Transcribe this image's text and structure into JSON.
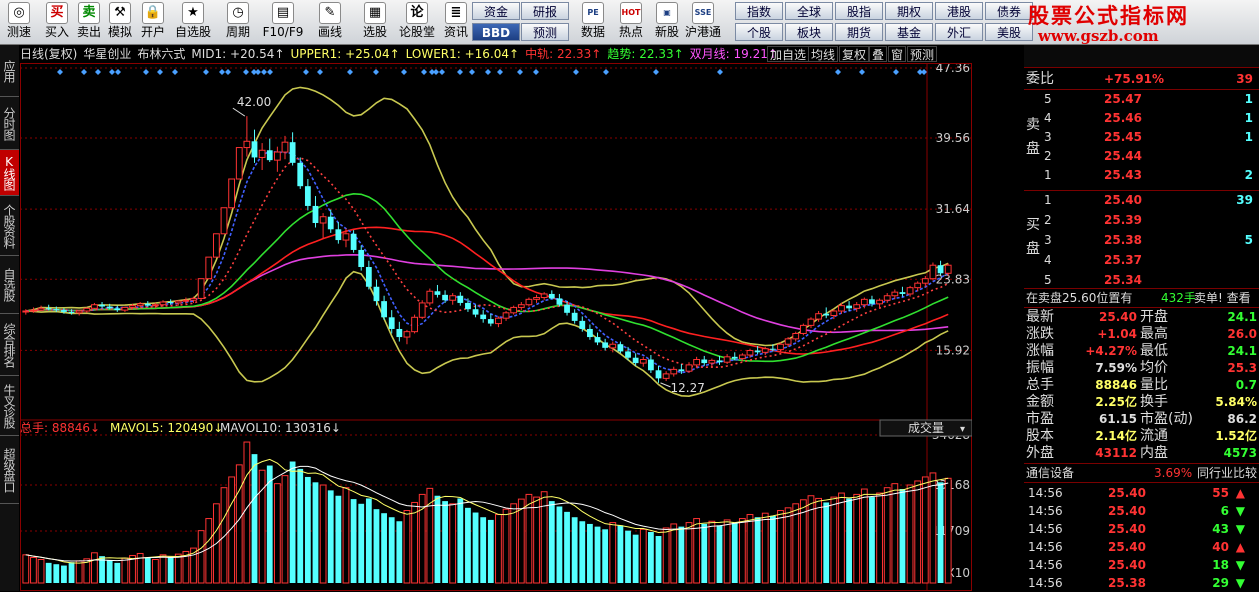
{
  "toolbar": {
    "buttons": [
      {
        "label": "测速",
        "icon": "◎",
        "name": "speed-test"
      },
      {
        "label": "买入",
        "icon": "买",
        "name": "buy"
      },
      {
        "label": "卖出",
        "icon": "卖",
        "name": "sell"
      },
      {
        "label": "模拟",
        "icon": "⚒",
        "name": "simulate"
      },
      {
        "label": "开户",
        "icon": "🔒",
        "name": "open-account"
      },
      {
        "label": "自选股",
        "icon": "★",
        "name": "watchlist"
      },
      {
        "label": "周期",
        "icon": "◷",
        "name": "period"
      },
      {
        "label": "F10/F9",
        "icon": "▤",
        "name": "f10"
      },
      {
        "label": "画线",
        "icon": "✎",
        "name": "draw-line"
      },
      {
        "label": "选股",
        "icon": "▦",
        "name": "stock-select"
      },
      {
        "label": "论股堂",
        "icon": "论",
        "name": "forum"
      },
      {
        "label": "资讯",
        "icon": "≣",
        "name": "news"
      }
    ],
    "mid_buttons": [
      {
        "label": "资金",
        "dark": false
      },
      {
        "label": "研报",
        "dark": false
      },
      {
        "label": "BBD",
        "dark": true
      },
      {
        "label": "预测",
        "dark": false
      }
    ],
    "icon_buttons": [
      {
        "label": "数据",
        "icon": "PE",
        "name": "data"
      },
      {
        "label": "热点",
        "icon": "HOT",
        "name": "hot"
      },
      {
        "label": "新股",
        "icon": "▣",
        "name": "new-stock"
      },
      {
        "label": "沪港通",
        "icon": "SSE",
        "name": "hk-connect"
      }
    ],
    "grid_top": [
      "指数",
      "全球",
      "股指",
      "期权",
      "港股",
      "债券"
    ],
    "grid_bottom": [
      "个股",
      "板块",
      "期货",
      "基金",
      "外汇",
      "美股"
    ]
  },
  "logo": {
    "line1": "股票公式指标网",
    "line2": "www.gszb.com"
  },
  "left_tabs": [
    {
      "label": "应用",
      "active": false
    },
    {
      "label": "分时图",
      "active": false
    },
    {
      "label": "K线图",
      "active": true
    },
    {
      "label": "个股资料",
      "active": false
    },
    {
      "label": "自选股",
      "active": false
    },
    {
      "label": "综合排名",
      "active": false
    },
    {
      "label": "牛叉诊股",
      "active": false
    },
    {
      "label": "超级盘口",
      "active": false
    }
  ],
  "infobar": {
    "items": [
      {
        "text": "日线(复权)",
        "color": "#dddddd"
      },
      {
        "text": "华星创业",
        "color": "#dddddd"
      },
      {
        "text": "布林六式",
        "color": "#dddddd"
      },
      {
        "text": "MID1: +20.54↑",
        "color": "#dddddd"
      },
      {
        "text": "UPPER1: +25.04↑",
        "color": "#ffff66"
      },
      {
        "text": "LOWER1: +16.04↑",
        "color": "#ffff66"
      },
      {
        "text": "中轨: 22.33↑",
        "color": "#ff3333"
      },
      {
        "text": "趋势: 22.33↑",
        "color": "#33ff33"
      },
      {
        "text": "双月线: 19.21↑",
        "color": "#ff55ff"
      }
    ],
    "buttons": [
      "加自选",
      "均线",
      "复权",
      "叠",
      "窗",
      "预测"
    ]
  },
  "price_axis": [
    "47.36",
    "39.56",
    "31.64",
    "23.83",
    "15.92"
  ],
  "vol_axis": [
    "34628",
    "23168",
    "11709",
    "X10"
  ],
  "annotations": {
    "high": "42.00",
    "low": "12.27",
    "vol_dropdown": "成交量"
  },
  "volume_bar": [
    {
      "text": "总手: 88846↓",
      "color": "#ff3333"
    },
    {
      "text": "MAVOL5: 120490↓",
      "color": "#ffff66"
    },
    {
      "text": "MAVOL10: 130316↓",
      "color": "#dddddd"
    }
  ],
  "chart_data": {
    "type": "candlestick",
    "title": "",
    "ylim": [
      9.5,
      47.36
    ],
    "y_ticks": [
      47.36,
      39.56,
      31.64,
      23.83,
      15.92
    ],
    "ohlc": [
      [
        20.2,
        20.5,
        19.9,
        20.3
      ],
      [
        20.3,
        20.7,
        20.1,
        20.4
      ],
      [
        20.4,
        20.9,
        20.3,
        20.6
      ],
      [
        20.6,
        21.0,
        20.4,
        20.5
      ],
      [
        20.5,
        20.8,
        20.2,
        20.4
      ],
      [
        20.4,
        20.6,
        20.0,
        20.2
      ],
      [
        20.2,
        20.5,
        19.9,
        20.1
      ],
      [
        20.1,
        20.4,
        19.8,
        20.3
      ],
      [
        20.3,
        20.7,
        20.1,
        20.6
      ],
      [
        20.6,
        21.2,
        20.5,
        21.0
      ],
      [
        21.0,
        21.3,
        20.6,
        20.8
      ],
      [
        20.8,
        21.1,
        20.5,
        20.6
      ],
      [
        20.6,
        20.9,
        20.2,
        20.4
      ],
      [
        20.4,
        20.8,
        20.2,
        20.7
      ],
      [
        20.7,
        21.1,
        20.5,
        20.9
      ],
      [
        20.9,
        21.3,
        20.7,
        21.1
      ],
      [
        21.1,
        21.4,
        20.8,
        20.9
      ],
      [
        20.9,
        21.2,
        20.6,
        21.0
      ],
      [
        21.0,
        21.5,
        20.8,
        21.3
      ],
      [
        21.3,
        21.6,
        21.0,
        21.2
      ],
      [
        21.2,
        21.5,
        20.9,
        21.4
      ],
      [
        21.4,
        21.8,
        21.1,
        21.5
      ],
      [
        21.5,
        21.9,
        21.2,
        21.7
      ],
      [
        21.7,
        23.9,
        21.6,
        23.9
      ],
      [
        23.9,
        26.3,
        23.9,
        26.3
      ],
      [
        26.3,
        28.9,
        26.3,
        28.9
      ],
      [
        28.9,
        31.8,
        28.9,
        31.8
      ],
      [
        31.8,
        35.0,
        31.8,
        35.0
      ],
      [
        35.0,
        38.5,
        35.0,
        38.5
      ],
      [
        38.5,
        42.0,
        37.5,
        39.2
      ],
      [
        39.2,
        40.5,
        36.8,
        37.4
      ],
      [
        37.4,
        39.0,
        36.0,
        38.2
      ],
      [
        38.2,
        39.5,
        36.9,
        37.1
      ],
      [
        37.1,
        38.6,
        35.8,
        38.0
      ],
      [
        38.0,
        39.8,
        37.2,
        39.1
      ],
      [
        39.1,
        40.2,
        36.5,
        36.8
      ],
      [
        36.8,
        37.4,
        33.9,
        34.2
      ],
      [
        34.2,
        35.0,
        31.5,
        32.0
      ],
      [
        32.0,
        33.1,
        29.6,
        30.1
      ],
      [
        30.1,
        31.2,
        28.4,
        30.8
      ],
      [
        30.8,
        31.6,
        29.0,
        29.4
      ],
      [
        29.4,
        30.2,
        27.8,
        28.2
      ],
      [
        28.2,
        29.5,
        27.4,
        28.9
      ],
      [
        28.9,
        29.3,
        26.8,
        27.1
      ],
      [
        27.1,
        27.6,
        24.8,
        25.2
      ],
      [
        25.2,
        25.9,
        22.7,
        23.0
      ],
      [
        23.0,
        23.8,
        20.9,
        21.4
      ],
      [
        21.4,
        22.0,
        19.3,
        19.6
      ],
      [
        19.6,
        20.4,
        17.8,
        18.3
      ],
      [
        18.3,
        19.1,
        16.9,
        17.4
      ],
      [
        17.4,
        18.2,
        16.6,
        18.0
      ],
      [
        18.0,
        19.9,
        17.8,
        19.6
      ],
      [
        19.6,
        21.5,
        19.4,
        21.2
      ],
      [
        21.2,
        22.8,
        20.9,
        22.5
      ],
      [
        22.5,
        23.2,
        21.8,
        22.1
      ],
      [
        22.1,
        22.6,
        21.2,
        21.5
      ],
      [
        21.5,
        22.3,
        21.0,
        22.0
      ],
      [
        22.0,
        22.4,
        20.9,
        21.2
      ],
      [
        21.2,
        21.7,
        20.2,
        20.5
      ],
      [
        20.5,
        21.0,
        19.6,
        19.9
      ],
      [
        19.9,
        20.4,
        19.0,
        19.4
      ],
      [
        19.4,
        20.0,
        18.6,
        18.9
      ],
      [
        18.9,
        19.7,
        18.5,
        19.5
      ],
      [
        19.5,
        20.3,
        19.2,
        20.1
      ],
      [
        20.1,
        20.9,
        19.9,
        20.7
      ],
      [
        20.7,
        21.3,
        20.4,
        21.0
      ],
      [
        21.0,
        21.8,
        20.8,
        21.6
      ],
      [
        21.6,
        22.1,
        21.2,
        21.8
      ],
      [
        21.8,
        22.4,
        21.5,
        22.2
      ],
      [
        22.2,
        22.6,
        21.6,
        21.7
      ],
      [
        21.7,
        22.2,
        20.8,
        21.0
      ],
      [
        21.0,
        21.4,
        19.8,
        20.1
      ],
      [
        20.1,
        20.5,
        18.9,
        19.2
      ],
      [
        19.2,
        19.7,
        18.0,
        18.3
      ],
      [
        18.3,
        18.8,
        17.1,
        17.4
      ],
      [
        17.4,
        17.9,
        16.5,
        16.8
      ],
      [
        16.8,
        17.2,
        15.9,
        16.2
      ],
      [
        16.2,
        16.9,
        15.7,
        16.6
      ],
      [
        16.6,
        16.9,
        15.6,
        15.8
      ],
      [
        15.8,
        16.3,
        14.8,
        15.1
      ],
      [
        15.1,
        15.6,
        14.2,
        14.5
      ],
      [
        14.5,
        15.2,
        14.1,
        14.9
      ],
      [
        14.9,
        15.4,
        13.4,
        13.7
      ],
      [
        13.7,
        14.2,
        12.3,
        12.8
      ],
      [
        12.8,
        13.6,
        12.5,
        13.3
      ],
      [
        13.3,
        14.1,
        13.0,
        13.8
      ],
      [
        13.8,
        14.4,
        13.3,
        13.6
      ],
      [
        13.6,
        14.6,
        13.4,
        14.3
      ],
      [
        14.3,
        15.2,
        14.0,
        14.9
      ],
      [
        14.9,
        15.3,
        14.2,
        14.5
      ],
      [
        14.5,
        15.0,
        14.1,
        14.8
      ],
      [
        14.8,
        15.3,
        14.3,
        14.6
      ],
      [
        14.6,
        15.5,
        14.4,
        15.2
      ],
      [
        15.2,
        15.7,
        14.8,
        15.0
      ],
      [
        15.0,
        15.6,
        14.7,
        15.4
      ],
      [
        15.4,
        16.1,
        15.1,
        15.9
      ],
      [
        15.9,
        16.4,
        15.5,
        15.7
      ],
      [
        15.7,
        16.3,
        15.4,
        16.1
      ],
      [
        16.1,
        16.6,
        15.8,
        16.0
      ],
      [
        16.0,
        16.8,
        15.8,
        16.6
      ],
      [
        16.6,
        17.4,
        16.3,
        17.2
      ],
      [
        17.2,
        18.0,
        16.9,
        17.8
      ],
      [
        17.8,
        18.9,
        17.6,
        18.7
      ],
      [
        18.7,
        19.6,
        18.4,
        19.4
      ],
      [
        19.4,
        20.3,
        19.1,
        20.0
      ],
      [
        20.0,
        20.7,
        19.5,
        19.8
      ],
      [
        19.8,
        20.5,
        19.4,
        20.3
      ],
      [
        20.3,
        21.2,
        20.0,
        20.9
      ],
      [
        20.9,
        21.4,
        20.3,
        20.6
      ],
      [
        20.6,
        21.3,
        20.2,
        21.0
      ],
      [
        21.0,
        21.8,
        20.6,
        21.6
      ],
      [
        21.6,
        22.0,
        20.8,
        21.1
      ],
      [
        21.1,
        21.7,
        20.7,
        21.5
      ],
      [
        21.5,
        22.3,
        21.2,
        22.0
      ],
      [
        22.0,
        22.7,
        21.6,
        22.4
      ],
      [
        22.4,
        23.0,
        21.9,
        22.2
      ],
      [
        22.2,
        23.1,
        21.9,
        22.9
      ],
      [
        22.9,
        23.6,
        22.5,
        23.4
      ],
      [
        23.4,
        24.2,
        23.0,
        23.9
      ],
      [
        23.9,
        25.7,
        23.7,
        25.4
      ],
      [
        25.4,
        25.9,
        24.3,
        24.5
      ],
      [
        24.5,
        25.6,
        24.2,
        25.4
      ]
    ],
    "volume": [
      42,
      38,
      35,
      30,
      28,
      26,
      31,
      33,
      36,
      45,
      40,
      34,
      30,
      37,
      41,
      44,
      38,
      35,
      42,
      39,
      43,
      47,
      52,
      78,
      96,
      118,
      142,
      158,
      176,
      210,
      192,
      168,
      175,
      148,
      160,
      181,
      170,
      158,
      150,
      146,
      138,
      130,
      142,
      125,
      118,
      126,
      110,
      104,
      98,
      92,
      108,
      120,
      132,
      141,
      130,
      122,
      118,
      126,
      112,
      105,
      98,
      94,
      102,
      110,
      118,
      125,
      132,
      128,
      136,
      122,
      114,
      106,
      98,
      92,
      88,
      84,
      80,
      90,
      86,
      78,
      72,
      80,
      76,
      70,
      82,
      88,
      84,
      90,
      96,
      88,
      92,
      86,
      94,
      90,
      96,
      102,
      98,
      104,
      100,
      108,
      112,
      118,
      124,
      130,
      126,
      120,
      128,
      134,
      126,
      132,
      140,
      128,
      134,
      142,
      148,
      140,
      146,
      152,
      158,
      164,
      150,
      156
    ],
    "indicators": [
      "MID1",
      "UPPER1",
      "LOWER1",
      "中轨",
      "趋势",
      "双月线",
      "MAVOL5",
      "MAVOL10"
    ],
    "vol_ylim": [
      0,
      34628
    ]
  },
  "right_panel": {
    "ratio": {
      "label": "委比",
      "value": "+75.91%",
      "count": "39"
    },
    "sell_label": "卖盘",
    "sells": [
      {
        "n": "5",
        "p": "25.47",
        "v": "1"
      },
      {
        "n": "4",
        "p": "25.46",
        "v": "1"
      },
      {
        "n": "3",
        "p": "25.45",
        "v": "1"
      },
      {
        "n": "2",
        "p": "25.44",
        "v": ""
      },
      {
        "n": "1",
        "p": "25.43",
        "v": "2"
      }
    ],
    "buy_label": "买盘",
    "buys": [
      {
        "n": "1",
        "p": "25.40",
        "v": "39"
      },
      {
        "n": "2",
        "p": "25.39",
        "v": ""
      },
      {
        "n": "3",
        "p": "25.38",
        "v": "5"
      },
      {
        "n": "4",
        "p": "25.37",
        "v": ""
      },
      {
        "n": "5",
        "p": "25.34",
        "v": ""
      }
    ],
    "notice": {
      "text": "在卖盘25.60位置有",
      "vol": "432手",
      "tail": "卖单! 查看详情"
    },
    "stats": [
      {
        "l1": "最新",
        "v1": "25.40",
        "c1": "#ff3333",
        "l2": "开盘",
        "v2": "24.1",
        "c2": "#33ff33"
      },
      {
        "l1": "涨跌",
        "v1": "+1.04",
        "c1": "#ff3333",
        "l2": "最高",
        "v2": "26.0",
        "c2": "#ff3333"
      },
      {
        "l1": "涨幅",
        "v1": "+4.27%",
        "c1": "#ff3333",
        "l2": "最低",
        "v2": "24.1",
        "c2": "#33ff33"
      },
      {
        "l1": "振幅",
        "v1": "7.59%",
        "c1": "#dddddd",
        "l2": "均价",
        "v2": "25.3",
        "c2": "#ff3333"
      },
      {
        "l1": "总手",
        "v1": "88846",
        "c1": "#ffff66",
        "l2": "量比",
        "v2": "0.7",
        "c2": "#33ff33"
      },
      {
        "l1": "金额",
        "v1": "2.25亿",
        "c1": "#ffff66",
        "l2": "换手",
        "v2": "5.84%",
        "c2": "#ffff66"
      },
      {
        "l1": "市盈",
        "v1": "61.15",
        "c1": "#dddddd",
        "l2": "市盈(动)",
        "v2": "86.2",
        "c2": "#dddddd"
      },
      {
        "l1": "股本",
        "v1": "2.14亿",
        "c1": "#ffff66",
        "l2": "流通",
        "v2": "1.52亿",
        "c2": "#ffff66"
      },
      {
        "l1": "外盘",
        "v1": "43112",
        "c1": "#ff3333",
        "l2": "内盘",
        "v2": "4573",
        "c2": "#33ff33"
      }
    ],
    "sector": {
      "name": "通信设备",
      "pct": "3.69%",
      "compare": "同行业比较"
    },
    "ticks": [
      {
        "t": "14:56",
        "p": "25.40",
        "v": "55",
        "up": true
      },
      {
        "t": "14:56",
        "p": "25.40",
        "v": "6",
        "up": false
      },
      {
        "t": "14:56",
        "p": "25.40",
        "v": "43",
        "up": false
      },
      {
        "t": "14:56",
        "p": "25.40",
        "v": "40",
        "up": true
      },
      {
        "t": "14:56",
        "p": "25.40",
        "v": "18",
        "up": false
      },
      {
        "t": "14:56",
        "p": "25.38",
        "v": "29",
        "up": false
      }
    ]
  }
}
